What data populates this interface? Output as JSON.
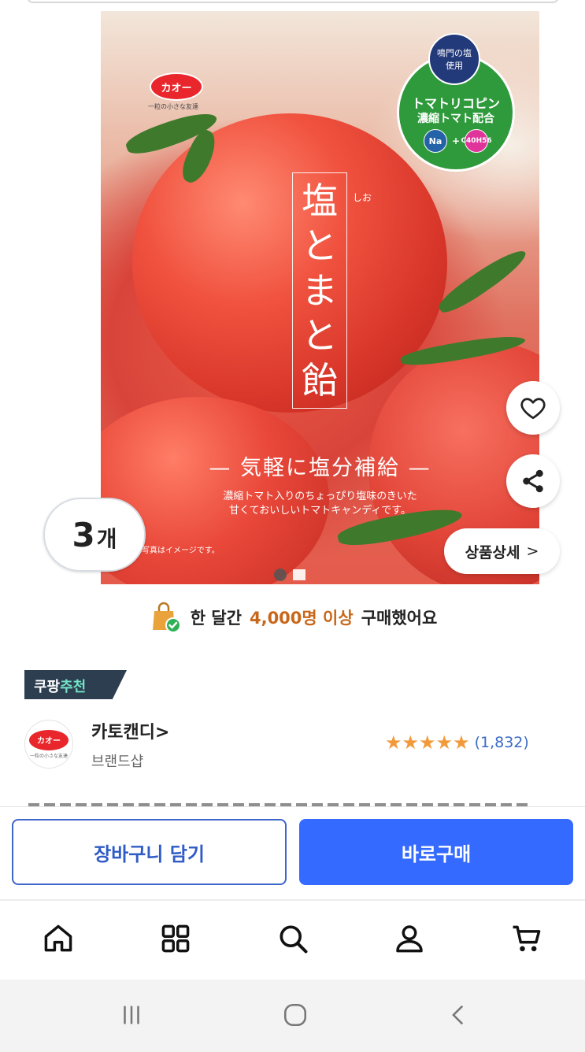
{
  "product_image": {
    "brand_logo_text": "カオー",
    "brand_tagline": "一粒の小さな友達",
    "badge_top_line1": "鳴門の塩",
    "badge_top_line2": "使用",
    "badge_line1": "トマトリコピン",
    "badge_line2": "濃縮トマト配合",
    "badge_na": "Na",
    "badge_chem": "C40H56",
    "title_chars": [
      "塩",
      "と",
      "ま",
      "と",
      "飴"
    ],
    "title_furigana": "しお",
    "subtitle": "— 気軽に塩分補給 —",
    "description_line1": "濃縮トマト入りのちょっぴり塩味のきいた",
    "description_line2": "甘くておいしいトマトキャンディです。",
    "photo_note": "写真はイメージです。"
  },
  "quantity_badge": {
    "number": "3",
    "unit": "개"
  },
  "detail_button_label": "상품상세",
  "detail_chevron": ">",
  "purchase_info": {
    "prefix": "한 달간",
    "highlight": "4,000명 이상",
    "suffix": "구매했어요"
  },
  "recommend": {
    "part1": "쿠팡",
    "part2": "추천"
  },
  "brand": {
    "logo_text": "カオー",
    "logo_sub": "一粒の小さな友達",
    "name": "카토캔디>",
    "shop": "브랜드샵"
  },
  "rating": {
    "stars": 5,
    "count": "(1,832)"
  },
  "actions": {
    "cart_label": "장바구니 담기",
    "buy_label": "바로구매"
  },
  "nav_items": [
    "home-icon",
    "category-icon",
    "search-icon",
    "user-icon",
    "cart-icon"
  ],
  "colors": {
    "accent_blue": "#346aff",
    "highlight_orange": "#c8671a",
    "star": "#f29a3b",
    "rating_blue": "#3b6bc7",
    "recommend_dark": "#2c3e50",
    "recommend_teal": "#73e3c6"
  }
}
